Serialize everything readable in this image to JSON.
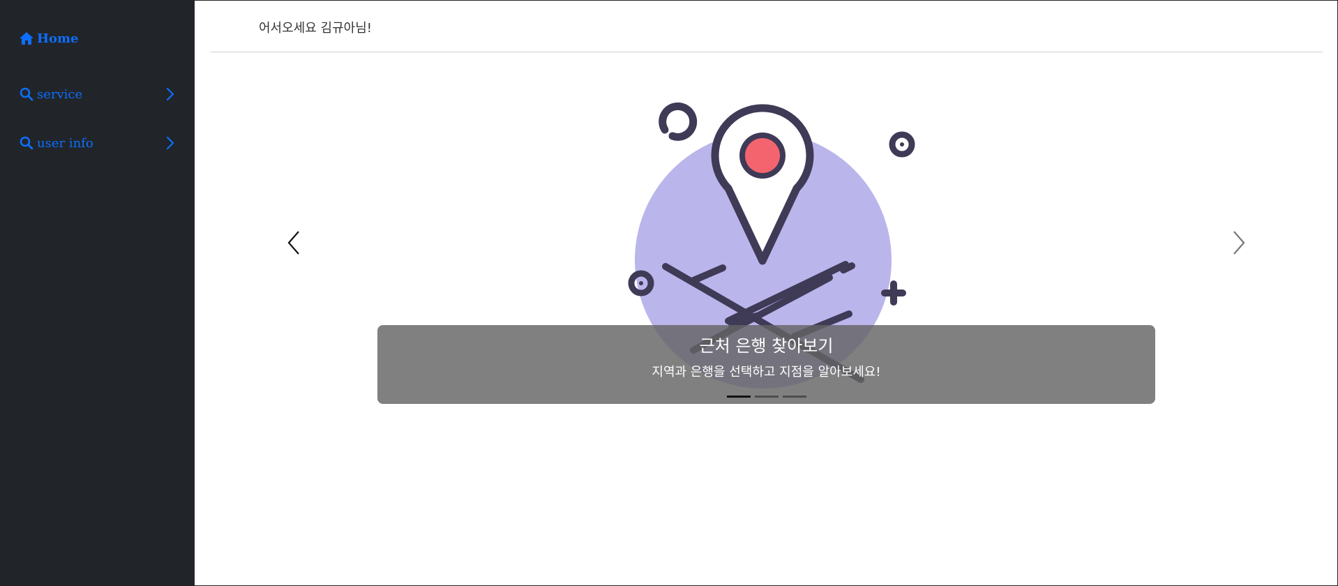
{
  "sidebar": {
    "items": [
      {
        "label": "Home",
        "icon": "home-icon"
      },
      {
        "label": "service",
        "icon": "search-icon",
        "trailing_icon": "chevron-right-icon"
      },
      {
        "label": "user info",
        "icon": "search-icon",
        "trailing_icon": "chevron-right-icon"
      }
    ]
  },
  "header": {
    "welcome": "어서오세요 김규아님!"
  },
  "carousel": {
    "slide_title": "근처 은행 찾아보기",
    "slide_subtitle": "지역과 은행을 선택하고 지점을 알아보세요!",
    "image_icon": "map-location-pin-icon",
    "prev_icon": "chevron-left-icon",
    "next_icon": "chevron-right-icon",
    "slide_count": 3,
    "active_index": 0
  },
  "colors": {
    "sidebar_bg": "#212529",
    "link": "#0d6efd",
    "circle": "#bab6ec",
    "pin_dot": "#f4646f",
    "ink": "#3f3a56"
  }
}
